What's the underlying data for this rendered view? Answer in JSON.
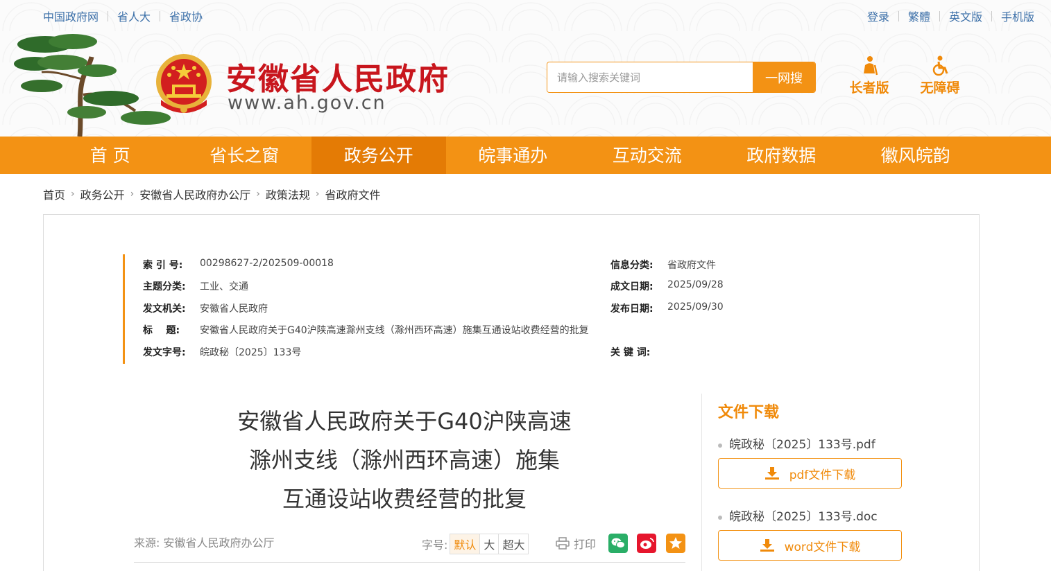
{
  "top_links_left": [
    "中国政府网",
    "省人大",
    "省政协"
  ],
  "top_links_right": [
    "登录",
    "繁體",
    "英文版",
    "手机版"
  ],
  "site": {
    "title": "安徽省人民政府",
    "url": "www.ah.gov.cn"
  },
  "search": {
    "placeholder": "请输入搜索关键词",
    "button": "一网搜"
  },
  "modes": {
    "elder": "长者版",
    "access": "无障碍"
  },
  "nav": [
    "首 页",
    "省长之窗",
    "政务公开",
    "皖事通办",
    "互动交流",
    "政府数据",
    "徽风皖韵"
  ],
  "nav_active": "政务公开",
  "breadcrumb": [
    "首页",
    "政务公开",
    "安徽省人民政府办公厅",
    "政策法规",
    "省政府文件"
  ],
  "meta": {
    "index_key": "索 引 号:",
    "index_val": "00298627-2/202509-00018",
    "theme_key": "主题分类:",
    "theme_val": "工业、交通",
    "issuer_key": "发文机关:",
    "issuer_val": "安徽省人民政府",
    "title_key": "标    题:",
    "title_val": "安徽省人民政府关于G40沪陕高速滁州支线（滁州西环高速）施集互通设站收费经营的批复",
    "docno_key": "发文字号:",
    "docno_val": "皖政秘〔2025〕133号",
    "category_key": "信息分类:",
    "category_val": "省政府文件",
    "written_key": "成文日期:",
    "written_val": "2025/09/28",
    "published_key": "发布日期:",
    "published_val": "2025/09/30",
    "keywords_key": "关 键 词:",
    "keywords_val": ""
  },
  "doc_title_lines": [
    "安徽省人民政府关于G40沪陕高速",
    "滁州支线（滁州西环高速）施集",
    "互通设站收费经营的批复"
  ],
  "source": "来源: 安徽省人民政府办公厅",
  "fontsize": {
    "label": "字号:",
    "options": [
      "默认",
      "大",
      "超大"
    ]
  },
  "print_label": "打印",
  "share_icons": [
    "wechat-icon",
    "weibo-icon",
    "favorite-icon"
  ],
  "downloads": {
    "title": "文件下载",
    "files": [
      {
        "name": "皖政秘〔2025〕133号.pdf",
        "button": "pdf文件下载"
      },
      {
        "name": "皖政秘〔2025〕133号.doc",
        "button": "word文件下载"
      }
    ]
  },
  "colors": {
    "accent": "#f39214",
    "accent_dark": "#e47b05",
    "title_red": "#c8161d",
    "link_blue": "#3b6fa8",
    "wechat": "#2aae67",
    "weibo": "#e6162d",
    "favorite": "#f39214"
  }
}
